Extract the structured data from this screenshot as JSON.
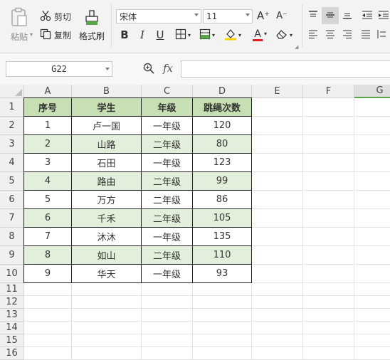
{
  "ribbon": {
    "paste_label": "粘贴",
    "cut_label": "剪切",
    "copy_label": "复制",
    "format_painter_label": "格式刷",
    "font_name": "宋体",
    "font_size": "11",
    "bold": "B",
    "italic": "I",
    "underline": "U",
    "font_color_letter": "A",
    "grow_font": "A⁺",
    "shrink_font": "A⁻"
  },
  "formula_bar": {
    "name_box": "G22",
    "fx_label": "fx",
    "formula_value": ""
  },
  "sheet": {
    "columns": [
      "A",
      "B",
      "C",
      "D",
      "E",
      "F",
      "G"
    ],
    "row_numbers": [
      "1",
      "2",
      "3",
      "4",
      "5",
      "6",
      "7",
      "8",
      "9",
      "10",
      "11",
      "12",
      "13",
      "14",
      "15",
      "16"
    ],
    "header": [
      "序号",
      "学生",
      "年级",
      "跳绳次数"
    ],
    "rows": [
      [
        "1",
        "卢一国",
        "一年级",
        "120"
      ],
      [
        "2",
        "山路",
        "二年级",
        "80"
      ],
      [
        "3",
        "石田",
        "一年级",
        "123"
      ],
      [
        "4",
        "路由",
        "二年级",
        "99"
      ],
      [
        "5",
        "万方",
        "二年级",
        "86"
      ],
      [
        "6",
        "千禾",
        "二年级",
        "105"
      ],
      [
        "7",
        "沐沐",
        "一年级",
        "135"
      ],
      [
        "8",
        "如山",
        "二年级",
        "110"
      ],
      [
        "9",
        "华天",
        "一年级",
        "93"
      ]
    ]
  },
  "colors": {
    "header_fill": "#c6e0b4",
    "band_fill": "#e2efda",
    "font_color_bar": "#e02020",
    "fill_color_bar": "#f7d300",
    "active_col": "#e0e0e0"
  },
  "icons": [
    "scissors-icon",
    "copy-icon",
    "paintbrush-icon",
    "paste-icon",
    "borders-icon",
    "cell-style-icon",
    "fill-color-icon",
    "eraser-icon",
    "align-top-icon",
    "align-middle-icon",
    "align-bottom-icon",
    "align-left-icon",
    "align-center-icon",
    "align-right-icon",
    "justify-icon",
    "indent-decrease-icon",
    "indent-increase-icon",
    "zoom-icon"
  ]
}
